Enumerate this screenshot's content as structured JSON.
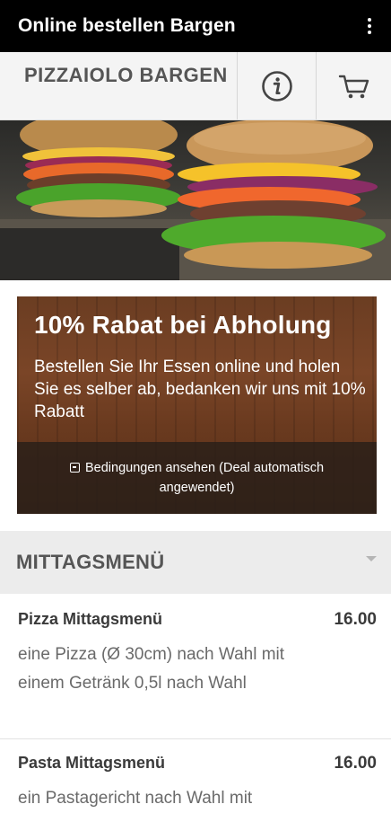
{
  "appbar": {
    "title": "Online bestellen Bargen",
    "menu_icon": "kebab-menu-icon"
  },
  "shop": {
    "name": "PIZZAIOLO BARGEN",
    "info_icon": "info-icon",
    "cart_icon": "cart-icon"
  },
  "hero": {
    "image": "burger-photo"
  },
  "promo": {
    "title": "10% Rabat bei Abholung",
    "description": "Bestellen Sie Ihr Essen online und holen Sie es selber ab, bedanken wir uns mit 10% Rabatt",
    "terms_label": "Bedingungen ansehen (Deal automatisch angewendet)"
  },
  "section": {
    "title": "MITTAGSMENÜ",
    "toggle_icon": "caret-down-icon"
  },
  "menu": {
    "items": [
      {
        "name": "Pizza Mittagsmenü",
        "price": "16.00",
        "description": "eine Pizza (Ø 30cm) nach Wahl mit einem Getränk 0,5l nach Wahl"
      },
      {
        "name": "Pasta Mittagsmenü",
        "price": "16.00",
        "description": "ein Pastagericht nach Wahl mit"
      }
    ]
  },
  "colors": {
    "appbar": "#000000",
    "shopbar": "#f4f4f4",
    "promo_wood": "#6b3d22",
    "section_bg": "#ececec"
  }
}
